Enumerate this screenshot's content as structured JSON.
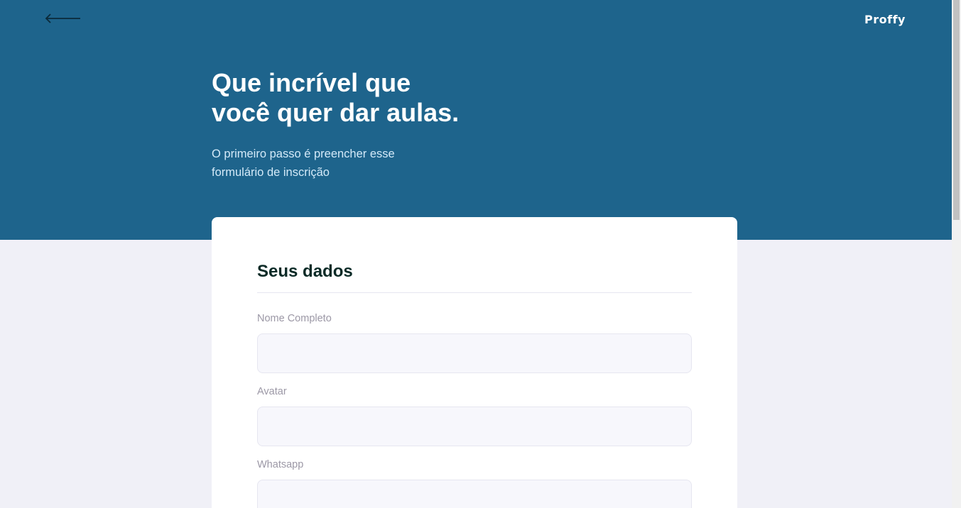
{
  "app": {
    "logo": "Proffy",
    "back_icon": "arrow-left-icon",
    "colors": {
      "primary": "#1e648c",
      "background": "#f0f0f7",
      "card": "#ffffff",
      "subtitle": "#d4eaf9",
      "heading_dark": "#0b2a26",
      "label": "#9c98a6",
      "input_bg": "#f7f7fc",
      "input_border": "#e6e6f0"
    }
  },
  "header": {
    "title": "Que incrível que\nvocê quer dar aulas.",
    "subtitle": "O primeiro passo é preencher esse\nformulário de inscrição"
  },
  "form": {
    "legend": "Seus dados",
    "fields": [
      {
        "label": "Nome Completo",
        "value": ""
      },
      {
        "label": "Avatar",
        "value": ""
      },
      {
        "label": "Whatsapp",
        "value": ""
      }
    ]
  }
}
